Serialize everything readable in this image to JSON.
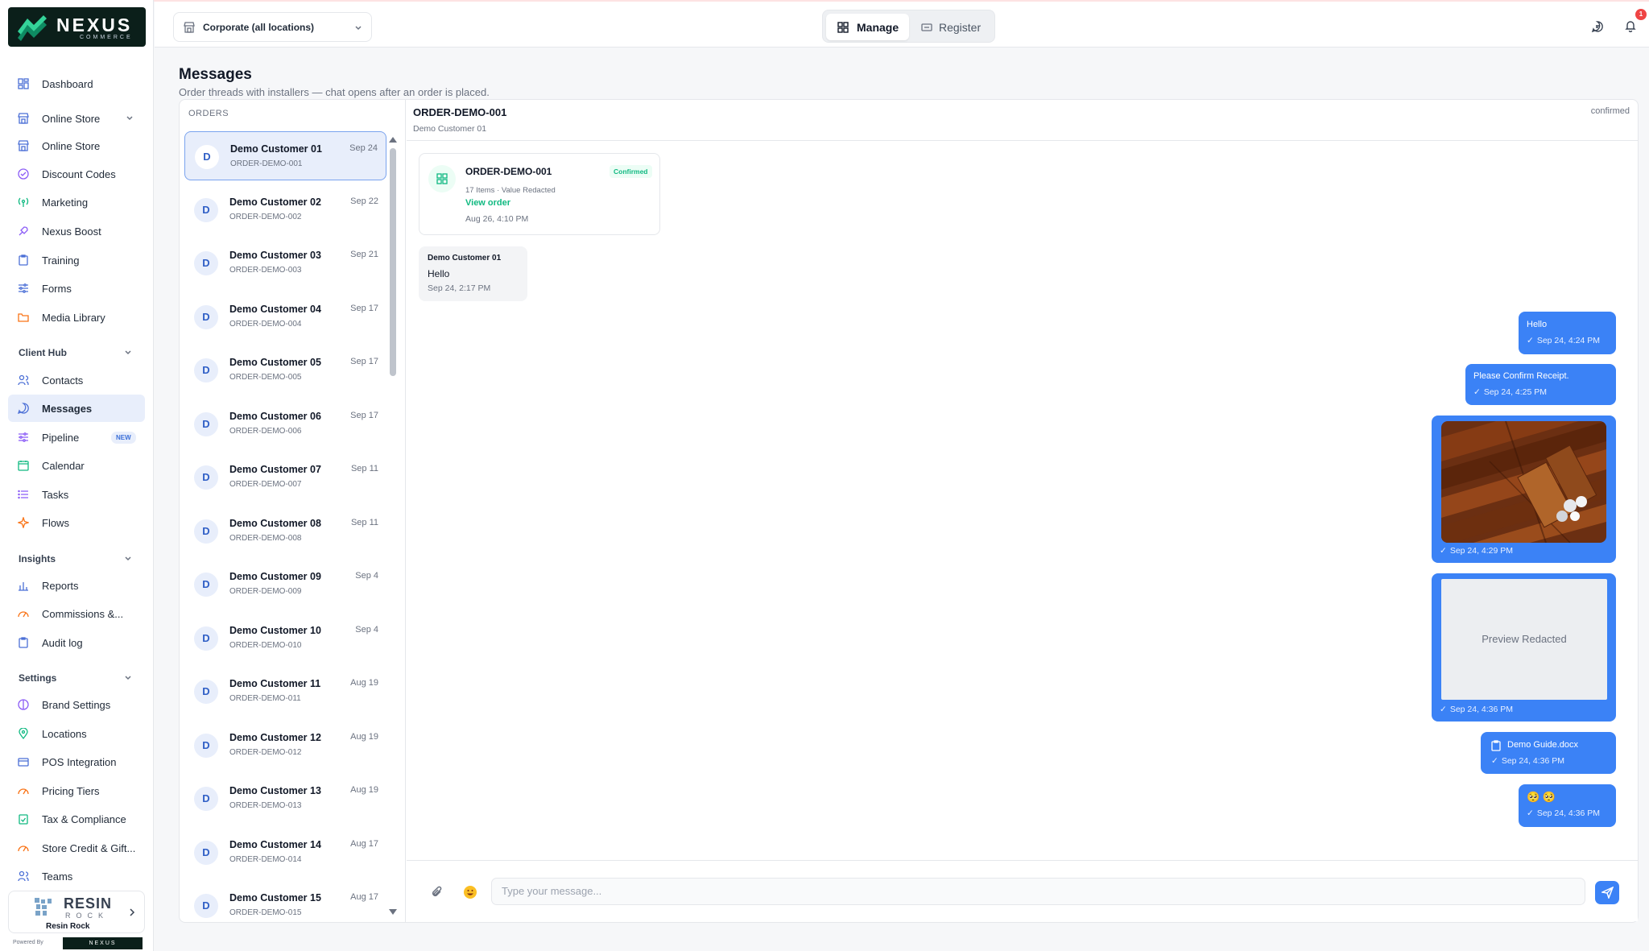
{
  "brand": {
    "name": "NEXUS",
    "tagline": "COMMERCE"
  },
  "sidebar": {
    "items": [
      {
        "label": "Dashboard",
        "icon": "dashboard-icon"
      },
      {
        "label": "Online Store",
        "icon": "store-icon",
        "expandable": true
      },
      {
        "label": "Online Store",
        "icon": "store-icon"
      },
      {
        "label": "Discount Codes",
        "icon": "discount-icon"
      },
      {
        "label": "Marketing",
        "icon": "broadcast-icon"
      },
      {
        "label": "Nexus Boost",
        "icon": "rocket-icon"
      },
      {
        "label": "Training",
        "icon": "clipboard-icon"
      },
      {
        "label": "Forms",
        "icon": "sliders-icon"
      },
      {
        "label": "Media Library",
        "icon": "folder-icon"
      }
    ],
    "sections": {
      "client_hub": "Client Hub",
      "insights": "Insights",
      "settings": "Settings"
    },
    "client_hub_items": [
      {
        "label": "Contacts",
        "icon": "users-icon"
      },
      {
        "label": "Messages",
        "icon": "chat-icon",
        "active": true
      },
      {
        "label": "Pipeline",
        "icon": "pipeline-icon",
        "badge": "NEW"
      },
      {
        "label": "Calendar",
        "icon": "calendar-icon"
      },
      {
        "label": "Tasks",
        "icon": "list-icon"
      },
      {
        "label": "Flows",
        "icon": "flow-icon"
      }
    ],
    "insights_items": [
      {
        "label": "Reports",
        "icon": "bar-chart-icon"
      },
      {
        "label": "Commissions &...",
        "icon": "gauge-icon"
      },
      {
        "label": "Audit log",
        "icon": "clipboard-icon"
      }
    ],
    "settings_items": [
      {
        "label": "Brand Settings",
        "icon": "palette-icon"
      },
      {
        "label": "Locations",
        "icon": "pin-icon"
      },
      {
        "label": "POS Integration",
        "icon": "card-icon"
      },
      {
        "label": "Pricing Tiers",
        "icon": "gauge-icon"
      },
      {
        "label": "Tax & Compliance",
        "icon": "clipboard-check-icon"
      },
      {
        "label": "Store Credit & Gift...",
        "icon": "gauge-icon"
      },
      {
        "label": "Teams",
        "icon": "users-icon"
      }
    ],
    "account": {
      "logo_line1": "RESIN",
      "logo_line2": "ROCK",
      "name": "Resin Rock"
    },
    "powered_by": "Powered By",
    "powered_logo": "NEXUS"
  },
  "header": {
    "location": "Corporate (all locations)",
    "modes": {
      "manage": "Manage",
      "register": "Register"
    },
    "notification_count": "1"
  },
  "page": {
    "title": "Messages",
    "subtitle": "Order threads with installers — chat opens after an order is placed."
  },
  "orders": {
    "heading": "ORDERS",
    "list": [
      {
        "avatar": "D",
        "name": "Demo Customer 01",
        "order": "ORDER-DEMO-001",
        "date": "Sep 24"
      },
      {
        "avatar": "D",
        "name": "Demo Customer 02",
        "order": "ORDER-DEMO-002",
        "date": "Sep 22"
      },
      {
        "avatar": "D",
        "name": "Demo Customer 03",
        "order": "ORDER-DEMO-003",
        "date": "Sep 21"
      },
      {
        "avatar": "D",
        "name": "Demo Customer 04",
        "order": "ORDER-DEMO-004",
        "date": "Sep 17"
      },
      {
        "avatar": "D",
        "name": "Demo Customer 05",
        "order": "ORDER-DEMO-005",
        "date": "Sep 17"
      },
      {
        "avatar": "D",
        "name": "Demo Customer 06",
        "order": "ORDER-DEMO-006",
        "date": "Sep 17"
      },
      {
        "avatar": "D",
        "name": "Demo Customer 07",
        "order": "ORDER-DEMO-007",
        "date": "Sep 11"
      },
      {
        "avatar": "D",
        "name": "Demo Customer 08",
        "order": "ORDER-DEMO-008",
        "date": "Sep 11"
      },
      {
        "avatar": "D",
        "name": "Demo Customer 09",
        "order": "ORDER-DEMO-009",
        "date": "Sep 4"
      },
      {
        "avatar": "D",
        "name": "Demo Customer 10",
        "order": "ORDER-DEMO-010",
        "date": "Sep 4"
      },
      {
        "avatar": "D",
        "name": "Demo Customer 11",
        "order": "ORDER-DEMO-011",
        "date": "Aug 19"
      },
      {
        "avatar": "D",
        "name": "Demo Customer 12",
        "order": "ORDER-DEMO-012",
        "date": "Aug 19"
      },
      {
        "avatar": "D",
        "name": "Demo Customer 13",
        "order": "ORDER-DEMO-013",
        "date": "Aug 19"
      },
      {
        "avatar": "D",
        "name": "Demo Customer 14",
        "order": "ORDER-DEMO-014",
        "date": "Aug 17"
      },
      {
        "avatar": "D",
        "name": "Demo Customer 15",
        "order": "ORDER-DEMO-015",
        "date": "Aug 17"
      }
    ]
  },
  "chat": {
    "order_id": "ORDER-DEMO-001",
    "customer": "Demo Customer 01",
    "status": "confirmed",
    "order_card": {
      "id": "ORDER-DEMO-001",
      "badge": "Confirmed",
      "meta": "17 Items · Value Redacted",
      "link": "View order",
      "date": "Aug 26, 4:10 PM"
    },
    "incoming": {
      "sender": "Demo Customer 01",
      "text": "Hello",
      "time": "Sep 24, 2:17 PM"
    },
    "outgoing": [
      {
        "text": "Hello",
        "time": "Sep 24, 4:24 PM"
      },
      {
        "text": "Please Confirm Receipt.",
        "time": "Sep 24, 4:25 PM"
      },
      {
        "time": "Sep 24, 4:29 PM",
        "kind": "image"
      },
      {
        "text": "Preview Redacted",
        "time": "Sep 24, 4:36 PM",
        "kind": "preview"
      },
      {
        "text": "Demo Guide.docx",
        "time": "Sep 24, 4:36 PM",
        "kind": "file"
      },
      {
        "text": "🥺 🥺",
        "time": "Sep 24, 4:36 PM"
      }
    ],
    "composer_placeholder": "Type your message..."
  },
  "colors": {
    "accent": "#3b82f6",
    "success": "#10b981",
    "active_bg": "#e8eefb",
    "brand_dark": "#0b1f1a"
  }
}
